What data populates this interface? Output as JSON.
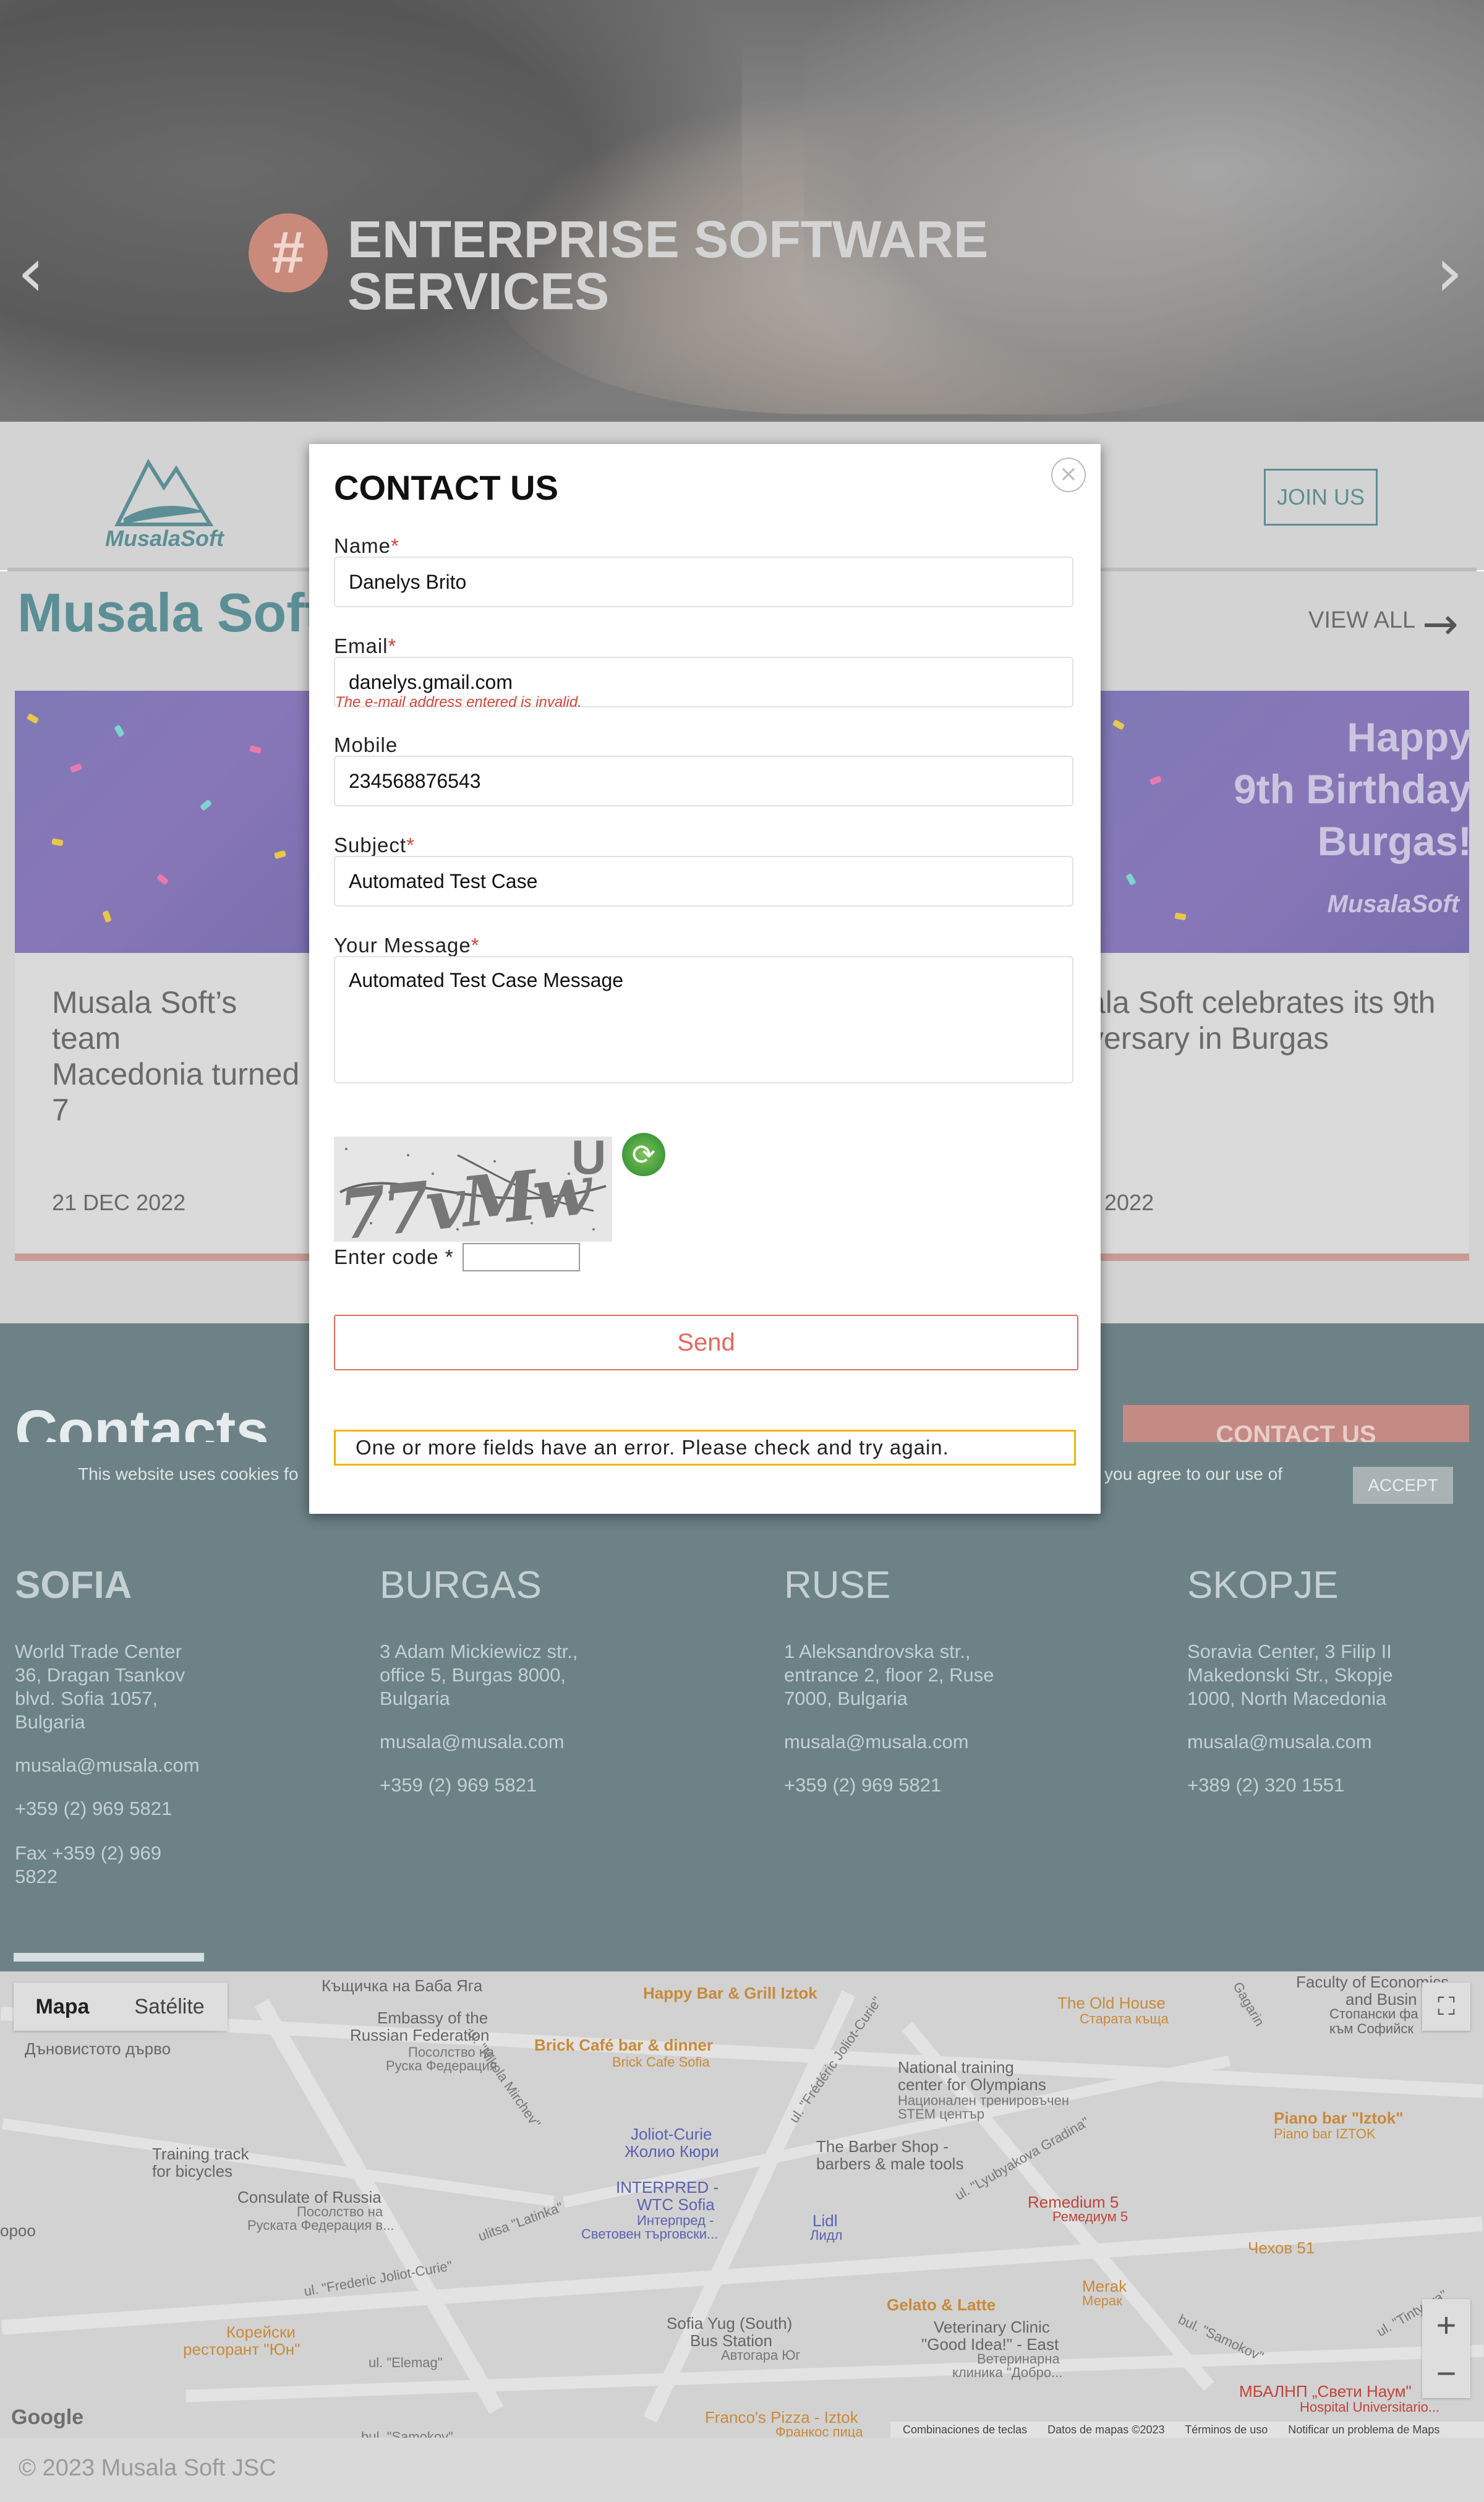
{
  "hero": {
    "hash": "#",
    "title_line1": "ENTERPRISE SOFTWARE",
    "title_line2": "SERVICES",
    "prev": "‹",
    "next": "›"
  },
  "nav": {
    "logo_text": "MusalaSoft",
    "join_us": "JOIN US"
  },
  "news": {
    "title": "Musala Soft I",
    "view_all": "VIEW ALL",
    "cards": [
      {
        "title": "Musala Soft’s team\nMacedonia turned 7",
        "date": "21 DEC 2022"
      },
      {
        "title": "ala Soft celebrates its 9th\nversary in Burgas",
        "date": "2022",
        "img_title": "Happy\n9th Birthday\nBurgas!",
        "img_brand": "MusalaSoft"
      }
    ]
  },
  "contacts": {
    "title": "Contacts",
    "contact_us_btn": "CONTACT US",
    "cookie_text_left": "This website uses cookies fo",
    "cookie_text_right": "you agree to our use of",
    "accept": "ACCEPT",
    "offices": [
      {
        "city": "SOFIA",
        "address": "World Trade Center\n36, Dragan Tsankov\nblvd. Sofia 1057,\nBulgaria",
        "email": "musala@musala.com",
        "phone": "+359 (2) 969 5821",
        "fax": "Fax +359 (2) 969\n5822"
      },
      {
        "city": "BURGAS",
        "address": "3 Adam Mickiewicz str.,\noffice 5, Burgas 8000,\nBulgaria",
        "email": "musala@musala.com",
        "phone": "+359 (2) 969 5821"
      },
      {
        "city": "RUSE",
        "address": "1 Aleksandrovska str.,\nentrance 2, floor 2, Ruse\n7000, Bulgaria",
        "email": "musala@musala.com",
        "phone": "+359 (2) 969 5821"
      },
      {
        "city": "SKOPJE",
        "address": "Soravia Center, 3 Filip II\nMakedonski Str., Skopje\n1000, North Macedonia",
        "email": "musala@musala.com",
        "phone": "+389 (2) 320 1551"
      }
    ]
  },
  "map": {
    "tab_map": "Mapa",
    "tab_sat": "Satélite",
    "google": "Google",
    "footer_links": [
      "Combinaciones de teclas",
      "Datos de mapas ©2023",
      "Términos de uso",
      "Notificar un problema de Maps"
    ],
    "pois": [
      "Къщичка на Баба Яга",
      "Happy Bar & Grill Iztok",
      "The Old House",
      "Старата къща",
      "Faculty of Economics",
      "and Busin",
      "Стопански фа",
      "към Софийск",
      "Embassy of the",
      "Russian Federation",
      "Посолство на",
      "Руска Федерация",
      "Brick Café bar & dinner",
      "Brick Cafe Sofia",
      "Дъновистото дърво",
      "National training",
      "center for Olympians",
      "Национален тренировъчен",
      "STEM център",
      "Joliot-Curie",
      "Жолио Кюри",
      "The Barber Shop -",
      "barbers & male tools",
      "Piano bar \"Iztok\"",
      "Piano bar IZTOK",
      "Training track",
      "for bicycles",
      "INTERPRED -",
      "WTC Sofia",
      "Интерпред -",
      "Световен търговски...",
      "Consulate of Russia",
      "Посолство на",
      "Руската Федерация в...",
      "Lidl",
      "Лидл",
      "Remedium 5",
      "Ремедиум 5",
      "Чехов 51",
      "ороо",
      "Gelato & Latte",
      "Merak",
      "Мерак",
      "Корейски",
      "ресторант \"Юн\"",
      "Sofia Yug (South)",
      "Bus Station",
      "Автогара Юг",
      "Veterinary Clinic",
      "\"Good Idea!\" - East",
      "Ветеринарна",
      "клиника \"Добро...",
      "МБАЛНП „Свети Наум\"",
      "Hospital Universitario...",
      "Franco's Pizza - Iztok",
      "Франкос пица",
      "ulitsa \"Latinka\"",
      "ul. \"Frederic Joliot-Curie\"",
      "ul. \"Nikola Mirchev\"",
      "ul. \"Lyubyakova Gradina\"",
      "ul. \"Elemag\"",
      "bul. \"Samokov\"",
      "bul. \"Samokov\"",
      "ul. \"Tintyava\"",
      "Gagarin",
      "ul. \"Frédéric Joliot-Curie\""
    ]
  },
  "footer": {
    "text": "© 2023 Musala Soft JSC"
  },
  "modal": {
    "title": "CONTACT US",
    "close": "×",
    "name_label": "Name",
    "name_value": "Danelys Brito",
    "email_label": "Email",
    "email_value": "danelys.gmail.com",
    "email_error": "The e-mail address entered is invalid.",
    "mobile_label": "Mobile",
    "mobile_value": "234568876543",
    "subject_label": "Subject",
    "subject_value": "Automated Test Case",
    "message_label": "Your Message",
    "message_value": "Automated Test Case Message",
    "required_mark": "*",
    "captcha_text": "77vMw",
    "captcha_extra": "U",
    "enter_code_label": "Enter code *",
    "send": "Send",
    "error_message": "One or more fields have an error. Please check and try again."
  },
  "colors": {
    "brand_teal": "#5c8f95",
    "accent_coral": "#e06a5d",
    "error_red": "#d6443a",
    "warning_border": "#f0b400"
  }
}
